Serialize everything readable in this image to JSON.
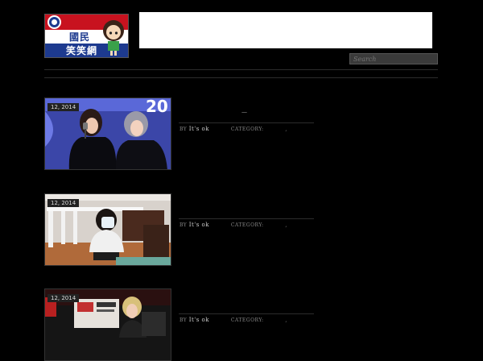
{
  "header": {
    "logo": {
      "line1": "國民",
      "line2": "笑笑網"
    },
    "search_placeholder": "Search"
  },
  "posts": [
    {
      "date": "12, 2014",
      "title": "—",
      "by_label": "BY",
      "author": "It's ok",
      "category_label": "CATEGORY:",
      "category_value": ","
    },
    {
      "date": "12, 2014",
      "by_label": "BY",
      "author": "It's ok",
      "category_label": "CATEGORY:",
      "category_value": ","
    },
    {
      "date": "12, 2014",
      "by_label": "BY",
      "author": "It's ok",
      "category_label": "CATEGORY:",
      "category_value": ","
    }
  ]
}
